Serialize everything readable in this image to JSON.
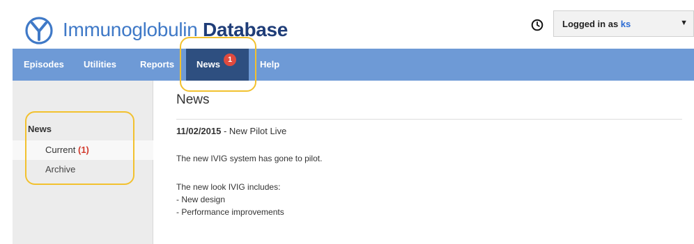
{
  "app": {
    "brand_light": "Immunoglobulin",
    "brand_dark": "Database",
    "colors": {
      "brand_blue": "#3f79c7",
      "brand_navy": "#1f3d78",
      "nav_bar": "#6e9ad6",
      "nav_active": "#2e4f80",
      "badge": "#e04a3e",
      "highlight": "#f2c12e"
    }
  },
  "header": {
    "clock_icon": "clock-icon",
    "user_prefix": "Logged in as",
    "username": "ks",
    "dropdown_icon": "caret-down-icon"
  },
  "nav": {
    "items": [
      {
        "label": "Episodes"
      },
      {
        "label": "Utilities"
      },
      {
        "label": "Reports"
      },
      {
        "label": "News",
        "badge": "1",
        "active": true
      },
      {
        "label": "Help"
      }
    ]
  },
  "sidebar": {
    "section_title": "News",
    "items": [
      {
        "label": "Current",
        "count": "(1)",
        "selected": true
      },
      {
        "label": "Archive"
      }
    ]
  },
  "main": {
    "title": "News",
    "article": {
      "date": "11/02/2015",
      "separator": " - ",
      "headline": "New Pilot Live",
      "lines": [
        "The new IVIG system has gone to pilot.",
        "The new look IVIG includes:",
        "- New design",
        "- Performance improvements"
      ]
    }
  }
}
